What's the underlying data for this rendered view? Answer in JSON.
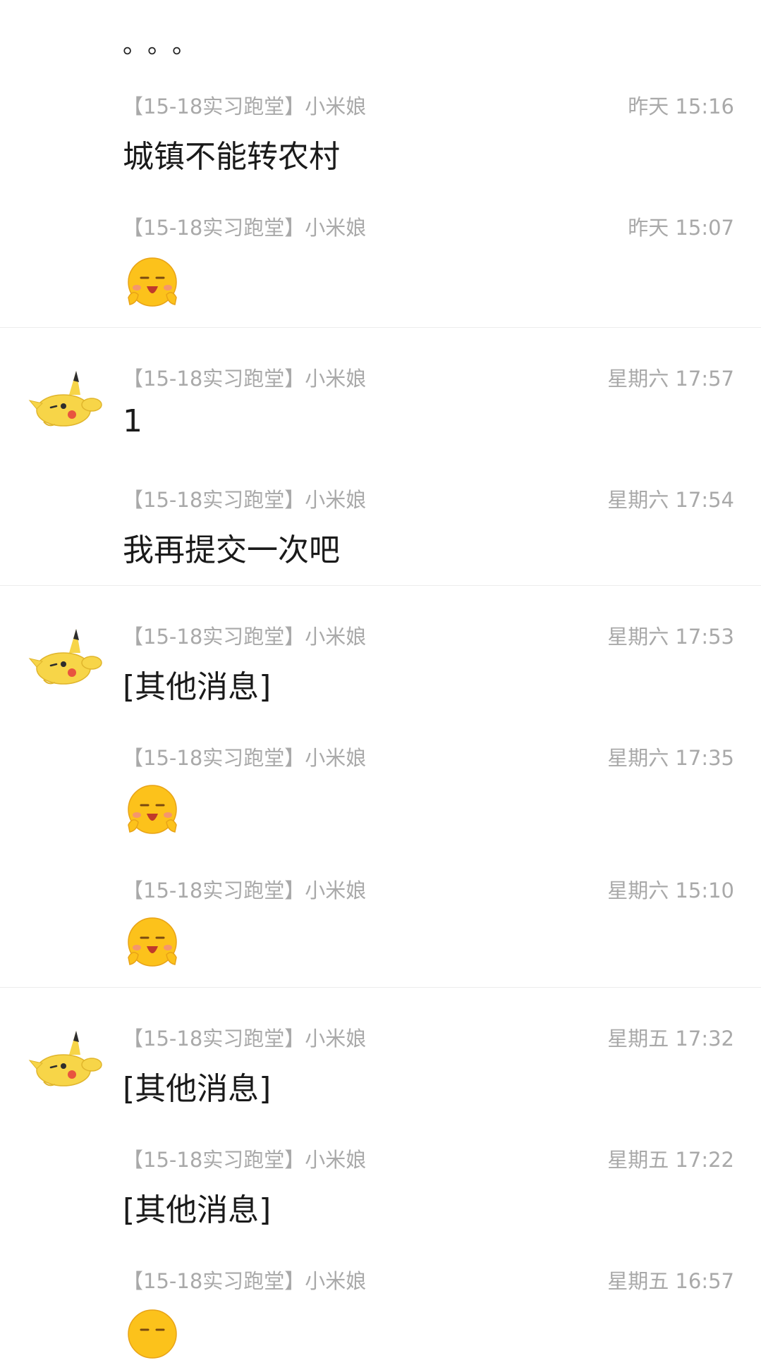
{
  "top_dots": "。。。",
  "messages": [
    {
      "sender": "【15-18实习跑堂】小米娘",
      "time": "昨天 15:16",
      "text": "城镇不能转农村"
    },
    {
      "sender": "【15-18实习跑堂】小米娘",
      "time": "昨天 15:07",
      "emoji": "blushing-face-emoji"
    },
    {
      "sender": "【15-18实习跑堂】小米娘",
      "time": "星期六 17:57",
      "text": "1",
      "avatar": "pikachu-avatar"
    },
    {
      "sender": "【15-18实习跑堂】小米娘",
      "time": "星期六 17:54",
      "text": "我再提交一次吧"
    },
    {
      "sender": "【15-18实习跑堂】小米娘",
      "time": "星期六 17:53",
      "text": "[其他消息]",
      "avatar": "pikachu-avatar"
    },
    {
      "sender": "【15-18实习跑堂】小米娘",
      "time": "星期六 17:35",
      "emoji": "blushing-face-emoji"
    },
    {
      "sender": "【15-18实习跑堂】小米娘",
      "time": "星期六 15:10",
      "emoji": "blushing-face-emoji"
    },
    {
      "sender": "【15-18实习跑堂】小米娘",
      "time": "星期五 17:32",
      "text": "[其他消息]",
      "avatar": "pikachu-avatar"
    },
    {
      "sender": "【15-18实习跑堂】小米娘",
      "time": "星期五 17:22",
      "text": "[其他消息]"
    },
    {
      "sender": "【15-18实习跑堂】小米娘",
      "time": "星期五 16:57",
      "emoji": "blushing-face-emoji"
    }
  ],
  "colors": {
    "meta_text": "#a9a9a9",
    "message_text": "#1a1a1a",
    "divider": "#ececec",
    "emoji_yellow": "#fcc21b",
    "pikachu_yellow": "#f7d548"
  }
}
